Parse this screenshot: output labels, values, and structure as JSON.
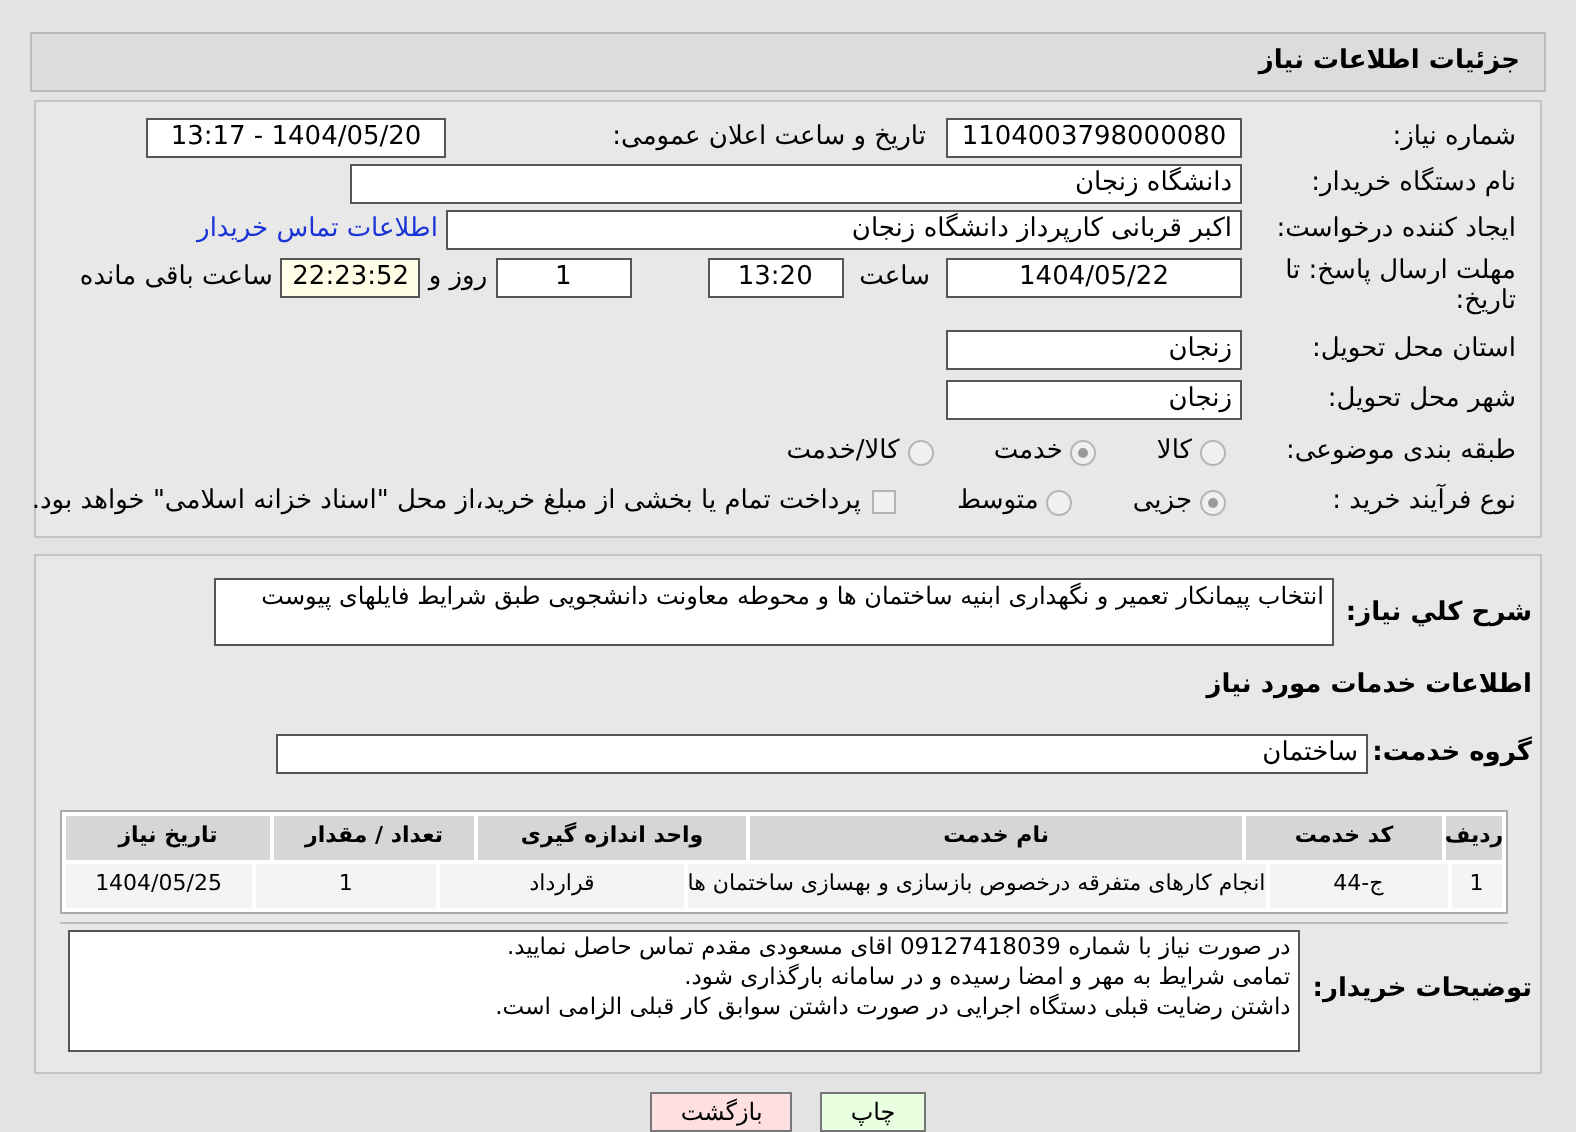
{
  "header": {
    "title": "جزئیات اطلاعات نیاز"
  },
  "form": {
    "need_number": {
      "label": "شماره نیاز:",
      "value": "1104003798000080"
    },
    "announce": {
      "label": "تاریخ و ساعت اعلان عمومی:",
      "value": "1404/05/20 - 13:17"
    },
    "buyer": {
      "label": "نام دستگاه خریدار:",
      "value": "دانشگاه زنجان"
    },
    "creator": {
      "label": "ایجاد کننده درخواست:",
      "value": "اکبر قربانی کارپرداز دانشگاه زنجان",
      "link": "اطلاعات تماس خریدار"
    },
    "deadline": {
      "label": "مهلت ارسال پاسخ: تا تاریخ:",
      "date": "1404/05/22",
      "time_label": "ساعت",
      "time": "13:20",
      "days": "1",
      "days_label": "روز و",
      "remaining": "22:23:52",
      "remaining_label": "ساعت باقی مانده"
    },
    "province": {
      "label": "استان محل تحویل:",
      "value": "زنجان"
    },
    "city": {
      "label": "شهر محل تحویل:",
      "value": "زنجان"
    },
    "category": {
      "label": "طبقه بندی موضوعی:",
      "options": [
        {
          "label": "کالا",
          "selected": false
        },
        {
          "label": "خدمت",
          "selected": true
        },
        {
          "label": "کالا/خدمت",
          "selected": false
        }
      ]
    },
    "process": {
      "label": "نوع فرآیند خرید :",
      "options": [
        {
          "label": "جزیی",
          "selected": true
        },
        {
          "label": "متوسط",
          "selected": false
        }
      ],
      "payment": {
        "label": "پرداخت تمام یا بخشی از مبلغ خرید،از محل \"اسناد خزانه اسلامی\" خواهد بود.",
        "checked": false
      }
    }
  },
  "details": {
    "summary": {
      "label": "شرح کلي نياز:",
      "value": "انتخاب پیمانکار تعمیر و نگهداری ابنیه ساختمان ها و محوطه معاونت دانشجویی طبق شرایط فایلهای پیوست"
    },
    "services_title": "اطلاعات خدمات مورد نیاز",
    "group": {
      "label": "گروه خدمت:",
      "value": "ساختمان"
    },
    "table": {
      "columns": [
        "ردیف",
        "کد خدمت",
        "نام خدمت",
        "واحد اندازه گیری",
        "تعداد / مقدار",
        "تاریخ نیاز"
      ],
      "rows": [
        [
          "1",
          "ج-44",
          "انجام کارهای متفرقه درخصوص بازسازی و بهسازی ساختمان ها",
          "قرارداد",
          "1",
          "1404/05/25"
        ]
      ]
    },
    "notes": {
      "label": "توضیحات خریدار:",
      "lines": [
        "در صورت نیاز با شماره 09127418039 اقای مسعودی مقدم تماس حاصل نمایید.",
        "تمامی شرایط به مهر و امضا رسیده و در سامانه بارگذاری شود.",
        "داشتن رضایت قبلی دستگاه اجرایی در صورت داشتن سوابق کار قبلی الزامی است."
      ]
    }
  },
  "buttons": [
    {
      "label": "چاپ",
      "kind": "print"
    },
    {
      "label": "بازگشت",
      "kind": "back"
    }
  ]
}
